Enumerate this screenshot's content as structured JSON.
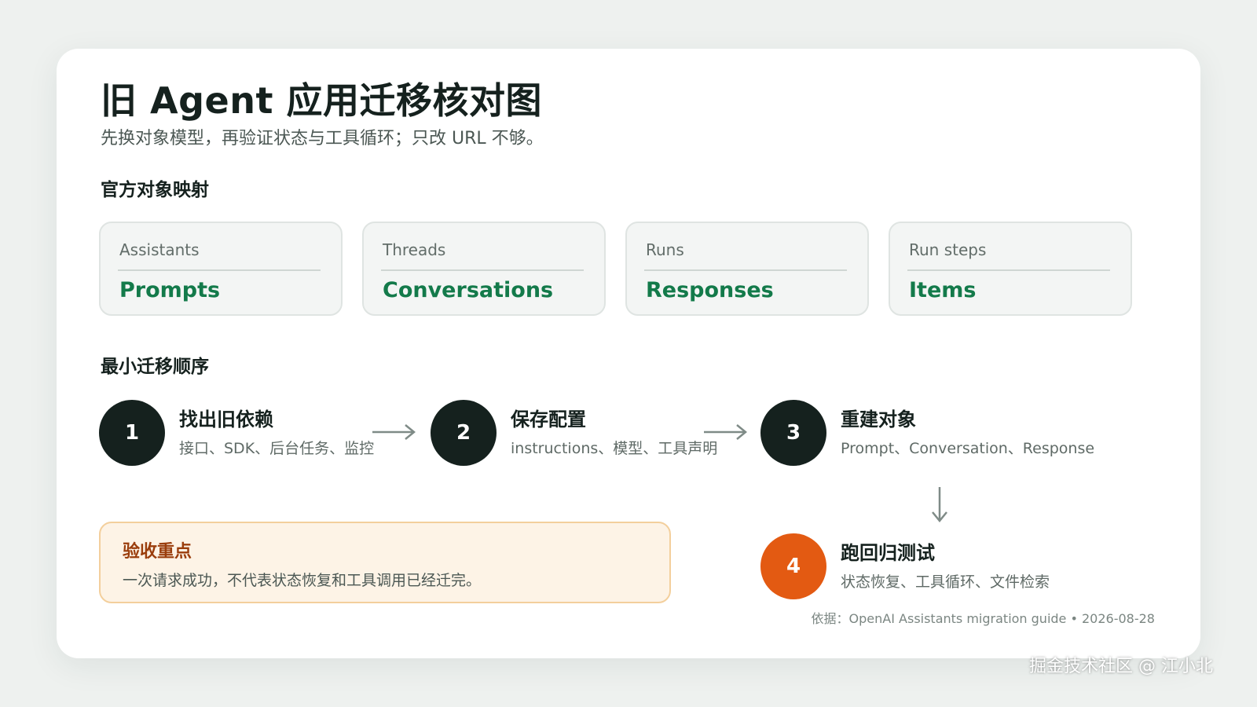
{
  "header": {
    "title": "旧 Agent 应用迁移核对图",
    "subtitle": "先换对象模型，再验证状态与工具循环；只改 URL 不够。"
  },
  "mapping": {
    "section_title": "官方对象映射",
    "items": [
      {
        "old": "Assistants",
        "new": "Prompts"
      },
      {
        "old": "Threads",
        "new": "Conversations"
      },
      {
        "old": "Runs",
        "new": "Responses"
      },
      {
        "old": "Run steps",
        "new": "Items"
      }
    ]
  },
  "migration": {
    "section_title": "最小迁移顺序",
    "steps": [
      {
        "number": "1",
        "title": "找出旧依赖",
        "desc": "接口、SDK、后台任务、监控"
      },
      {
        "number": "2",
        "title": "保存配置",
        "desc": "instructions、模型、工具声明"
      },
      {
        "number": "3",
        "title": "重建对象",
        "desc": "Prompt、Conversation、Response"
      },
      {
        "number": "4",
        "title": "跑回归测试",
        "desc": "状态恢复、工具循环、文件检索"
      }
    ]
  },
  "acceptance": {
    "title": "验收重点",
    "desc": "一次请求成功，不代表状态恢复和工具调用已经迁完。"
  },
  "footer": {
    "source": "依据：OpenAI Assistants migration guide  •  2026-08-28"
  },
  "watermark": "掘金技术社区 @ 江小北",
  "colors": {
    "accent_green": "#137a4a",
    "dark": "#15211e",
    "orange": "#e35a12",
    "warning_bg": "#fdf3e6",
    "warning_border": "#f3cf9c",
    "warning_title": "#9a3d0c"
  }
}
